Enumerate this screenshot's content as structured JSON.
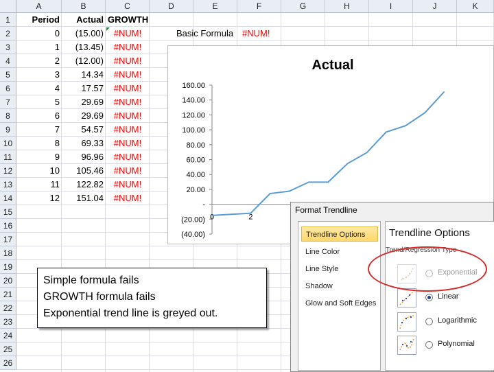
{
  "columns": [
    "A",
    "B",
    "C",
    "D",
    "E",
    "F",
    "G",
    "H",
    "I",
    "J",
    "K"
  ],
  "rows": [
    "1",
    "2",
    "3",
    "4",
    "5",
    "6",
    "7",
    "8",
    "9",
    "10",
    "11",
    "12",
    "13",
    "14",
    "15",
    "16",
    "17",
    "18",
    "19",
    "20",
    "21",
    "22",
    "23",
    "24",
    "25",
    "26"
  ],
  "headers": {
    "period": "Period",
    "actual": "Actual",
    "growth": "GROWTH"
  },
  "data": [
    {
      "period": "0",
      "actual": "(15.00)",
      "growth": "#NUM!"
    },
    {
      "period": "1",
      "actual": "(13.45)",
      "growth": "#NUM!"
    },
    {
      "period": "2",
      "actual": "(12.00)",
      "growth": "#NUM!"
    },
    {
      "period": "3",
      "actual": "14.34",
      "growth": "#NUM!"
    },
    {
      "period": "4",
      "actual": "17.57",
      "growth": "#NUM!"
    },
    {
      "period": "5",
      "actual": "29.69",
      "growth": "#NUM!"
    },
    {
      "period": "6",
      "actual": "29.69",
      "growth": "#NUM!"
    },
    {
      "period": "7",
      "actual": "54.57",
      "growth": "#NUM!"
    },
    {
      "period": "8",
      "actual": "69.33",
      "growth": "#NUM!"
    },
    {
      "period": "9",
      "actual": "96.96",
      "growth": "#NUM!"
    },
    {
      "period": "10",
      "actual": "105.46",
      "growth": "#NUM!"
    },
    {
      "period": "11",
      "actual": "122.82",
      "growth": "#NUM!"
    },
    {
      "period": "12",
      "actual": "151.04",
      "growth": "#NUM!"
    }
  ],
  "basic_formula": {
    "label": "Basic Formula",
    "value": "#NUM!"
  },
  "colors": {
    "error": "#ff0000",
    "series": "#5b9bd5",
    "highlight": "#d42a2a"
  },
  "chart_data": {
    "type": "line",
    "title": "Actual",
    "x": [
      0,
      1,
      2,
      3,
      4,
      5,
      6,
      7,
      8,
      9,
      10,
      11,
      12
    ],
    "series": [
      {
        "values": [
          -15.0,
          -13.45,
          -12.0,
          14.34,
          17.57,
          29.69,
          29.69,
          54.57,
          69.33,
          96.96,
          105.46,
          122.82,
          151.04
        ]
      }
    ],
    "ylim": [
      -40,
      160
    ],
    "y_ticks": [
      "160.00",
      "140.00",
      "120.00",
      "100.00",
      "80.00",
      "60.00",
      "40.00",
      "20.00",
      "-",
      "(20.00)",
      "(40.00)"
    ],
    "x_ticks_visible": [
      "0",
      "2"
    ],
    "grid": false,
    "legend": "none"
  },
  "dialog": {
    "title": "Format Trendline",
    "nav": [
      "Trendline Options",
      "Line Color",
      "Line Style",
      "Shadow",
      "Glow and Soft Edges"
    ],
    "selected_nav": "Trendline Options",
    "options_heading": "Trendline Options",
    "options_sub": "Trend/Regression Type",
    "trend_types": [
      {
        "label": "Exponential",
        "state": "disabled",
        "icon": "exponential-trend-icon"
      },
      {
        "label": "Linear",
        "state": "selected",
        "icon": "linear-trend-icon"
      },
      {
        "label": "Logarithmic",
        "state": "normal",
        "icon": "logarithmic-trend-icon"
      },
      {
        "label": "Polynomial",
        "state": "normal",
        "icon": "polynomial-trend-icon"
      }
    ]
  },
  "note": {
    "lines": [
      "Simple formula fails",
      "GROWTH formula fails",
      "Exponential trend line is greyed out."
    ]
  }
}
